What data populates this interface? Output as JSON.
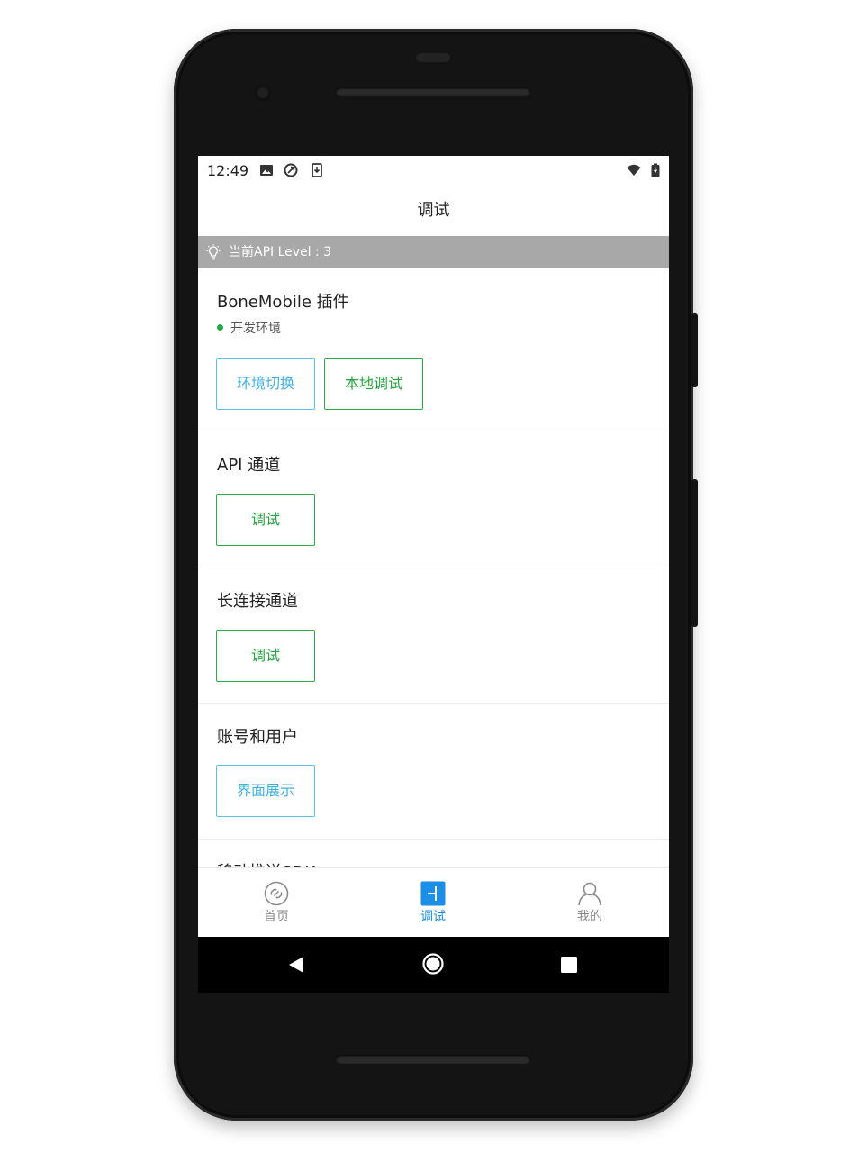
{
  "status_bar": {
    "time": "12:49",
    "left_icons": [
      "image-icon",
      "sync-icon",
      "download-icon"
    ],
    "right_icons": [
      "wifi-icon",
      "battery-icon"
    ]
  },
  "header": {
    "title": "调试"
  },
  "notice": {
    "icon": "lightbulb-icon",
    "text": "当前API Level : 3"
  },
  "sections": [
    {
      "title": "BoneMobile 插件",
      "subtitle": "开发环境",
      "status_color": "#23a945",
      "buttons": [
        {
          "label": "环境切换",
          "style": "blue"
        },
        {
          "label": "本地调试",
          "style": "green"
        }
      ]
    },
    {
      "title": "API 通道",
      "buttons": [
        {
          "label": "调试",
          "style": "green"
        }
      ]
    },
    {
      "title": "长连接通道",
      "buttons": [
        {
          "label": "调试",
          "style": "green"
        }
      ]
    },
    {
      "title": "账号和用户",
      "buttons": [
        {
          "label": "界面展示",
          "style": "blue"
        }
      ]
    },
    {
      "title": "移动推送SDK"
    }
  ],
  "tabbar": {
    "tabs": [
      {
        "label": "首页",
        "icon": "home-link-icon",
        "active": false
      },
      {
        "label": "调试",
        "icon": "debug-icon",
        "active": true
      },
      {
        "label": "我的",
        "icon": "user-icon",
        "active": false
      }
    ],
    "active_color": "#1d8ee5",
    "inactive_color": "#8a8a8a"
  },
  "nav_bar": {
    "buttons": [
      "back-icon",
      "home-icon",
      "recents-icon"
    ]
  },
  "colors": {
    "green": "#23a945",
    "blue": "#41b3e0",
    "notice_bg": "#a8a8a8"
  }
}
